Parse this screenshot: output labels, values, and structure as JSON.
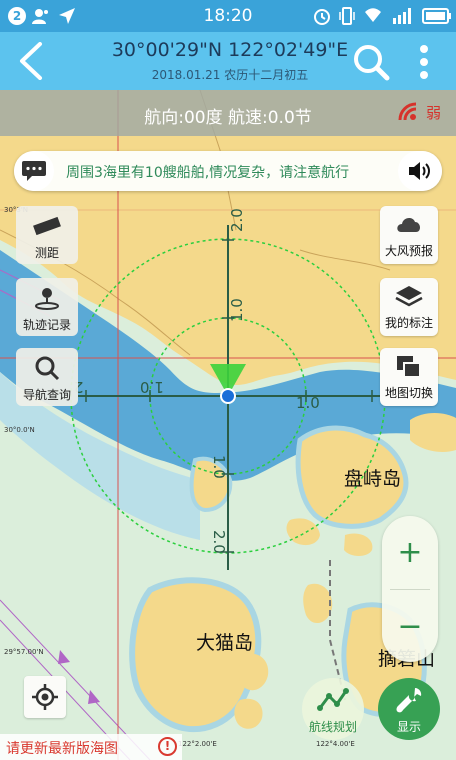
{
  "status_bar": {
    "notification_count": "2",
    "time": "18:20"
  },
  "header": {
    "coordinates": "30°00'29\"N 122°02'49\"E",
    "date": "2018.01.21  农历十二月初五"
  },
  "nav_info": {
    "text": "航向:00度   航速:0.0节",
    "signal_label": "弱"
  },
  "notice": {
    "text": "周围3海里有10艘船舶,情况复杂，请注意航行"
  },
  "left_tools": [
    {
      "label": "测距"
    },
    {
      "label": "轨迹记录"
    },
    {
      "label": "导航查询"
    }
  ],
  "right_tools": [
    {
      "label": "大风预报"
    },
    {
      "label": "我的标注"
    },
    {
      "label": "地图切换"
    }
  ],
  "zoom": {
    "in_label": "+",
    "out_label": "−"
  },
  "bottom": {
    "route_label": "航线规划",
    "display_label": "显示",
    "update_text": "请更新最新版海图",
    "update_icon": "!"
  },
  "map": {
    "island_1": "盘峙岛",
    "island_2": "大猫岛",
    "island_3": "摘箬山",
    "crosshair_labels": {
      "top_2": "2.0",
      "top_1": "1.0",
      "right_1": "1.0",
      "left_1": "1.0",
      "left_2": "2",
      "bottom_1": "1.0",
      "bottom_2": "2.0"
    },
    "edge_coords": [
      "30°3'N",
      "30°0.0'N",
      "29°57.00'N",
      "122°2.00'E",
      "122°4.00'E"
    ]
  },
  "colors": {
    "header": "#5cc3ee",
    "status": "#3aa3d9",
    "sea": "#5aa9d6",
    "land": "#f4d98b",
    "accent_green": "#2e8e4a",
    "alert_red": "#d93a30"
  }
}
